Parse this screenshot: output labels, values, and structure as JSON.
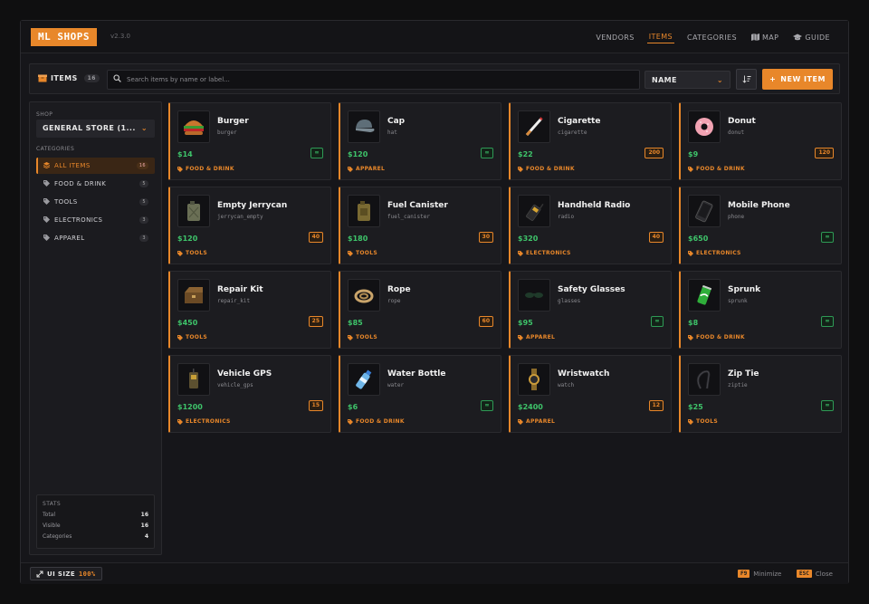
{
  "app": {
    "title": "ML SHOPS",
    "version": "v2.3.0"
  },
  "nav": [
    {
      "label": "VENDORS",
      "icon": "",
      "active": false
    },
    {
      "label": "ITEMS",
      "icon": "",
      "active": true
    },
    {
      "label": "CATEGORIES",
      "icon": "",
      "active": false
    },
    {
      "label": "MAP",
      "icon": "map-icon",
      "active": false
    },
    {
      "label": "GUIDE",
      "icon": "graduation-cap-icon",
      "active": false
    }
  ],
  "toolbar": {
    "title": "ITEMS",
    "count": "16",
    "search_placeholder": "Search items by name or label...",
    "sort_value": "NAME",
    "new_item_label": "NEW ITEM"
  },
  "sidebar": {
    "shop_label": "SHOP",
    "shop_value": "GENERAL STORE (1...",
    "categories_label": "CATEGORIES",
    "categories": [
      {
        "label": "ALL ITEMS",
        "count": "16",
        "active": true
      },
      {
        "label": "FOOD & DRINK",
        "count": "5",
        "active": false
      },
      {
        "label": "TOOLS",
        "count": "5",
        "active": false
      },
      {
        "label": "ELECTRONICS",
        "count": "3",
        "active": false
      },
      {
        "label": "APPAREL",
        "count": "3",
        "active": false
      }
    ],
    "stats": {
      "title": "STATS",
      "rows": [
        {
          "label": "Total",
          "value": "16"
        },
        {
          "label": "Visible",
          "value": "16"
        },
        {
          "label": "Categories",
          "value": "4"
        }
      ]
    }
  },
  "items": [
    {
      "name": "Burger",
      "code": "burger",
      "price": "$14",
      "stock": "∞",
      "category": "FOOD & DRINK",
      "icon": "burger-icon"
    },
    {
      "name": "Cap",
      "code": "hat",
      "price": "$120",
      "stock": "∞",
      "category": "APPAREL",
      "icon": "cap-icon"
    },
    {
      "name": "Cigarette",
      "code": "cigarette",
      "price": "$22",
      "stock": "200",
      "category": "FOOD & DRINK",
      "icon": "cigarette-icon"
    },
    {
      "name": "Donut",
      "code": "donut",
      "price": "$9",
      "stock": "120",
      "category": "FOOD & DRINK",
      "icon": "donut-icon"
    },
    {
      "name": "Empty Jerrycan",
      "code": "jerrycan_empty",
      "price": "$120",
      "stock": "40",
      "category": "TOOLS",
      "icon": "jerrycan-icon"
    },
    {
      "name": "Fuel Canister",
      "code": "fuel_canister",
      "price": "$180",
      "stock": "30",
      "category": "TOOLS",
      "icon": "fuel-canister-icon"
    },
    {
      "name": "Handheld Radio",
      "code": "radio",
      "price": "$320",
      "stock": "40",
      "category": "ELECTRONICS",
      "icon": "radio-icon"
    },
    {
      "name": "Mobile Phone",
      "code": "phone",
      "price": "$650",
      "stock": "∞",
      "category": "ELECTRONICS",
      "icon": "phone-icon"
    },
    {
      "name": "Repair Kit",
      "code": "repair_kit",
      "price": "$450",
      "stock": "25",
      "category": "TOOLS",
      "icon": "repair-kit-icon"
    },
    {
      "name": "Rope",
      "code": "rope",
      "price": "$85",
      "stock": "60",
      "category": "TOOLS",
      "icon": "rope-icon"
    },
    {
      "name": "Safety Glasses",
      "code": "glasses",
      "price": "$95",
      "stock": "∞",
      "category": "APPAREL",
      "icon": "glasses-icon"
    },
    {
      "name": "Sprunk",
      "code": "sprunk",
      "price": "$8",
      "stock": "∞",
      "category": "FOOD & DRINK",
      "icon": "soda-can-icon"
    },
    {
      "name": "Vehicle GPS",
      "code": "vehicle_gps",
      "price": "$1200",
      "stock": "15",
      "category": "ELECTRONICS",
      "icon": "gps-icon"
    },
    {
      "name": "Water Bottle",
      "code": "water",
      "price": "$6",
      "stock": "∞",
      "category": "FOOD & DRINK",
      "icon": "water-bottle-icon"
    },
    {
      "name": "Wristwatch",
      "code": "watch",
      "price": "$2400",
      "stock": "12",
      "category": "APPAREL",
      "icon": "watch-icon"
    },
    {
      "name": "Zip Tie",
      "code": "ziptie",
      "price": "$25",
      "stock": "∞",
      "category": "TOOLS",
      "icon": "zip-tie-icon"
    }
  ],
  "footer": {
    "ui_size_label": "UI SIZE",
    "ui_size_value": "100%",
    "hints": [
      {
        "key": "F9",
        "label": "Minimize"
      },
      {
        "key": "ESC",
        "label": "Close"
      }
    ]
  },
  "colors": {
    "accent": "#e8872a",
    "price": "#3ec46a",
    "background": "#16161a"
  }
}
